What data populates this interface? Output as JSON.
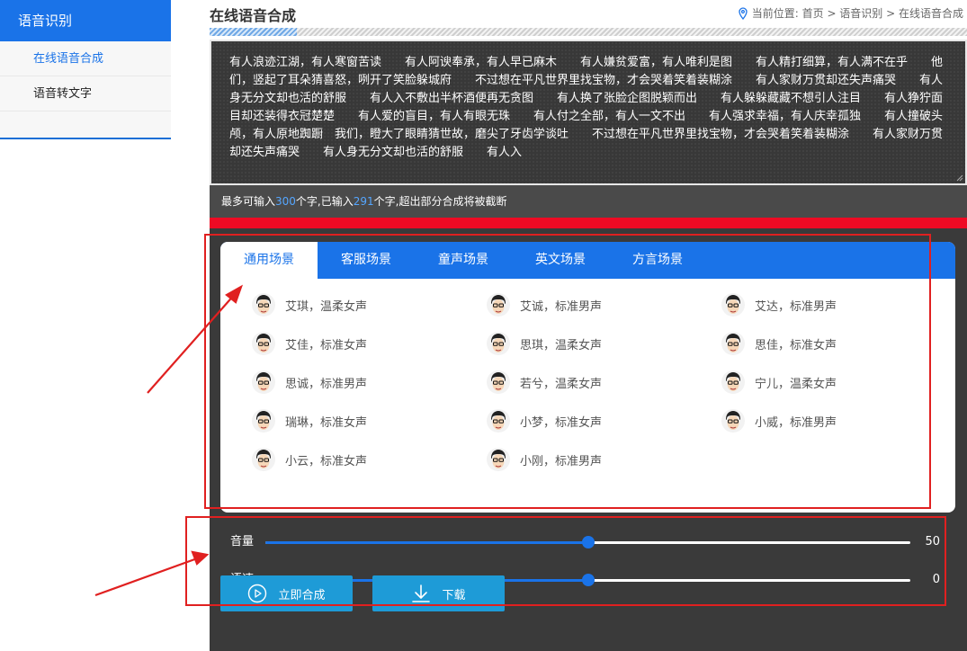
{
  "sidebar": {
    "header": "语音识别",
    "items": [
      {
        "label": "在线语音合成",
        "active": true
      },
      {
        "label": "语音转文字",
        "active": false
      }
    ]
  },
  "header": {
    "title": "在线语音合成",
    "breadcrumb": "当前位置: 首页 > 语音识别 > 在线语音合成"
  },
  "editor": {
    "text": "有人浪迹江湖，有人寒窗苦读　　有人阿谀奉承，有人早已麻木　　有人嫌贫爱富，有人唯利是图　　有人精打细算，有人满不在乎　　他们，竖起了耳朵猜喜怒，咧开了笑脸躲城府　　不过想在平凡世界里找宝物，才会哭着笑着装糊涂　　有人家财万贯却还失声痛哭　　有人身无分文却也活的舒服　　有人入不敷出半杯酒便再无贪图　　有人换了张脸企图脱颖而出　　有人躲躲藏藏不想引人注目　　有人狰狞面目却还装得衣冠楚楚　　有人爱的盲目，有人有眼无珠　　有人付之全部，有人一文不出　　有人强求幸福，有人庆幸孤独　　有人撞破头颅，有人原地踟蹰　我们，瞪大了眼睛猜世故，磨尖了牙齿学谈吐　　不过想在平凡世界里找宝物，才会哭着笑着装糊涂　　有人家财万贯却还失声痛哭　　有人身无分文却也活的舒服　　有人入",
    "info_prefix": "最多可输入",
    "max_chars": "300",
    "info_mid": "个字,已输入",
    "typed_chars": "291",
    "info_suffix": "个字,超出部分合成将被截断"
  },
  "tabs": [
    {
      "label": "通用场景",
      "active": true
    },
    {
      "label": "客服场景",
      "active": false
    },
    {
      "label": "童声场景",
      "active": false
    },
    {
      "label": "英文场景",
      "active": false
    },
    {
      "label": "方言场景",
      "active": false
    }
  ],
  "voices": [
    "艾琪，温柔女声",
    "艾诚，标准男声",
    "艾达，标准男声",
    "艾佳，标准女声",
    "思琪，温柔女声",
    "思佳，标准女声",
    "思诚，标准男声",
    "若兮，温柔女声",
    "宁儿，温柔女声",
    "瑞琳，标准女声",
    "小梦，标准女声",
    "小威，标准男声",
    "小云，标准女声",
    "小刚，标准男声"
  ],
  "sliders": [
    {
      "label": "音量",
      "value": "50",
      "fraction": 0.5
    },
    {
      "label": "语速",
      "value": "0",
      "fraction": 0.5
    }
  ],
  "buttons": {
    "synthesize": "立即合成",
    "download": "下载"
  },
  "colors": {
    "primary": "#1a73e8",
    "panel": "#3a3a3a",
    "red": "#ee0a24",
    "button": "#1e9bd7"
  }
}
